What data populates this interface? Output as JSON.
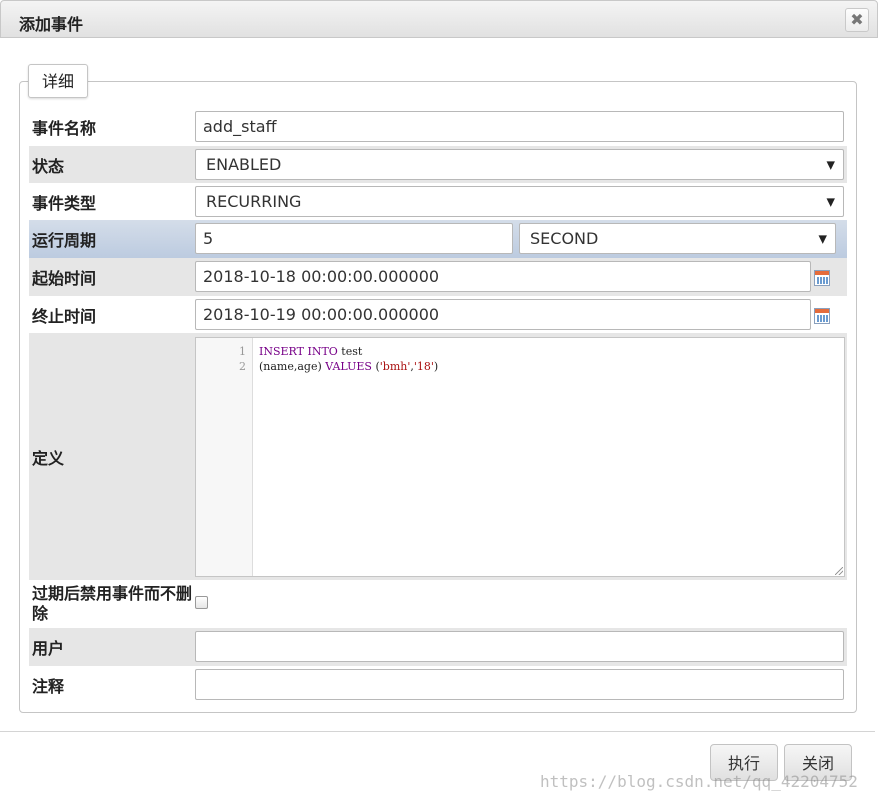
{
  "dialog": {
    "title": "添加事件",
    "close_symbol": "✖"
  },
  "tab": {
    "label": "详细"
  },
  "fields": {
    "event_name": {
      "label": "事件名称",
      "value": "add_staff"
    },
    "status": {
      "label": "状态",
      "value": "ENABLED"
    },
    "event_type": {
      "label": "事件类型",
      "value": "RECURRING"
    },
    "interval": {
      "label": "运行周期",
      "value": "5",
      "unit": "SECOND"
    },
    "start_time": {
      "label": "起始时间",
      "value": "2018-10-18 00:00:00.000000"
    },
    "end_time": {
      "label": "终止时间",
      "value": "2018-10-19 00:00:00.000000"
    },
    "definition": {
      "label": "定义",
      "line_numbers": [
        "1",
        "2"
      ],
      "line1": {
        "kw1": "INSERT",
        "kw2": "INTO",
        "rest": "test"
      },
      "line2": {
        "cols": "(name,age)",
        "kw": "VALUES",
        "open": "(",
        "v1": "'bmh'",
        "comma": ",",
        "v2": "'18'",
        "close": ")"
      }
    },
    "disable_on_expire": {
      "label": "过期后禁用事件而不删除",
      "checked": false
    },
    "user": {
      "label": "用户",
      "value": ""
    },
    "comment": {
      "label": "注释",
      "value": ""
    }
  },
  "buttons": {
    "execute": "执行",
    "close": "关闭"
  },
  "watermark": "https://blog.csdn.net/qq_42204752",
  "icons": {
    "select_arrow": "▼",
    "calendar": "calendar-icon"
  },
  "colors": {
    "active_row": "#bccbe0",
    "grey_row": "#e6e6e6",
    "keyword": "#770088",
    "string": "#aa1111"
  }
}
